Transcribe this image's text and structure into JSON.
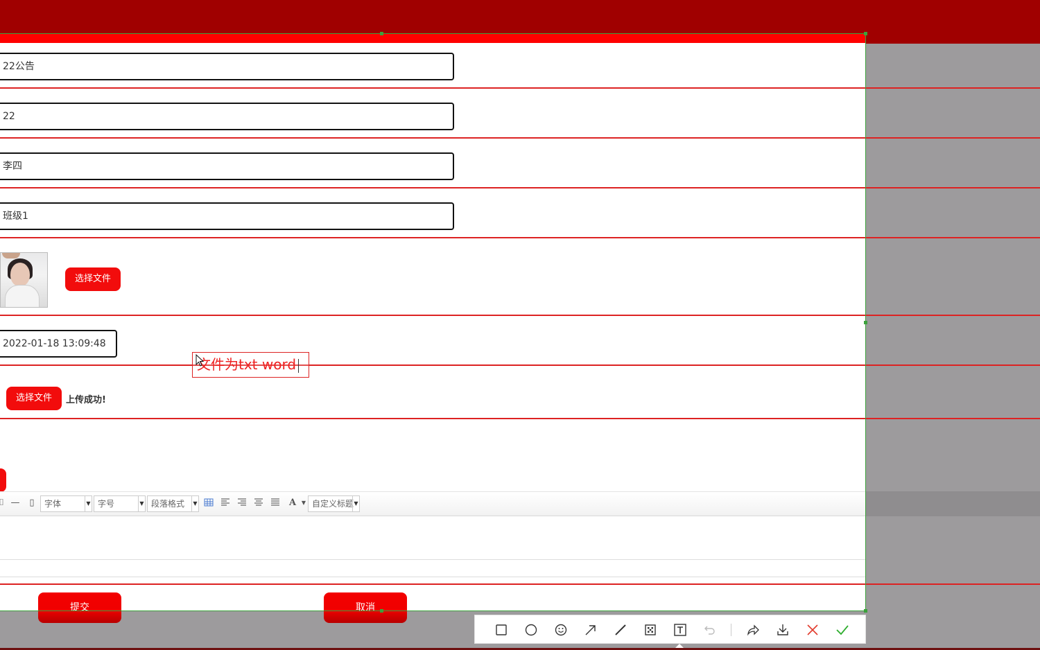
{
  "form": {
    "title_value": "22公告",
    "field2_value": "22",
    "author_value": "李四",
    "class_value": "班级1",
    "upload_image_label": "选择文件",
    "datetime_value": "2022-01-18 13:09:48",
    "upload_file_label": "选择文件",
    "upload_status": "上传成功!"
  },
  "annotation": {
    "text": "文件为txt  word"
  },
  "editor_toolbar": {
    "font_label": "字体",
    "size_label": "字号",
    "paragraph_label": "段落格式",
    "font_color_label": "A",
    "custom_title_label": "自定义标题",
    "dash_label": "—"
  },
  "actions": {
    "submit_label": "提交",
    "cancel_label": "取消"
  },
  "snapshot_tools": [
    {
      "name": "rectangle-icon",
      "glyph": "☐"
    },
    {
      "name": "ellipse-icon",
      "glyph": "○"
    },
    {
      "name": "emoji-icon",
      "glyph": "☺"
    },
    {
      "name": "arrow-icon",
      "glyph": "↗"
    },
    {
      "name": "pen-icon",
      "glyph": "╱"
    },
    {
      "name": "mosaic-icon",
      "glyph": "▣"
    },
    {
      "name": "text-icon",
      "glyph": "T"
    },
    {
      "name": "undo-icon",
      "glyph": "↶"
    },
    {
      "name": "share-icon",
      "glyph": "➦"
    },
    {
      "name": "download-icon",
      "glyph": "⤓"
    },
    {
      "name": "close-icon",
      "glyph": "✕"
    },
    {
      "name": "confirm-icon",
      "glyph": "✓"
    }
  ],
  "colors": {
    "header": "#a00000",
    "accent": "#f20c0c",
    "selection": "#3ca23c",
    "overlay": "#9d9b9d"
  }
}
